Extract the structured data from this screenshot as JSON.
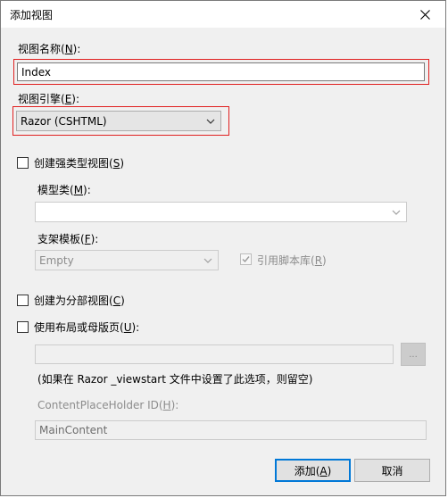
{
  "window": {
    "title": "添加视图"
  },
  "view_name": {
    "label_prefix": "视图名称(",
    "label_key": "N",
    "label_suffix": "):",
    "value": "Index"
  },
  "view_engine": {
    "label_prefix": "视图引擎(",
    "label_key": "E",
    "label_suffix": "):",
    "selected": "Razor (CSHTML)"
  },
  "strong_typed": {
    "label_prefix": "创建强类型视图(",
    "label_key": "S",
    "label_suffix": ")",
    "checked": false
  },
  "model_class": {
    "label_prefix": "模型类(",
    "label_key": "M",
    "label_suffix": "):",
    "selected": ""
  },
  "scaffold_template": {
    "label_prefix": "支架模板(",
    "label_key": "F",
    "label_suffix": "):",
    "selected": "Empty"
  },
  "reference_scripts": {
    "label_prefix": "引用脚本库(",
    "label_key": "R",
    "label_suffix": ")",
    "checked": true
  },
  "partial_view": {
    "label_prefix": "创建为分部视图(",
    "label_key": "C",
    "label_suffix": ")",
    "checked": false
  },
  "use_layout": {
    "label_prefix": "使用布局或母版页(",
    "label_key": "U",
    "label_suffix": "):",
    "checked": false,
    "path_value": "",
    "browse_label": "..."
  },
  "layout_hint": "(如果在 Razor _viewstart 文件中设置了此选项，则留空)",
  "content_placeholder": {
    "label_prefix": "ContentPlaceHolder ID(",
    "label_key": "H",
    "label_suffix": "):",
    "value": "MainContent"
  },
  "buttons": {
    "add_prefix": "添加(",
    "add_key": "A",
    "add_suffix": ")",
    "cancel": "取消"
  },
  "colors": {
    "highlight_frame": "#e02020",
    "default_button_border": "#0078d7",
    "dialog_background": "#f0f0f0"
  },
  "icons": {
    "close": "close-icon",
    "dropdown": "chevron-down-icon",
    "checkmark": "checkmark-icon"
  }
}
